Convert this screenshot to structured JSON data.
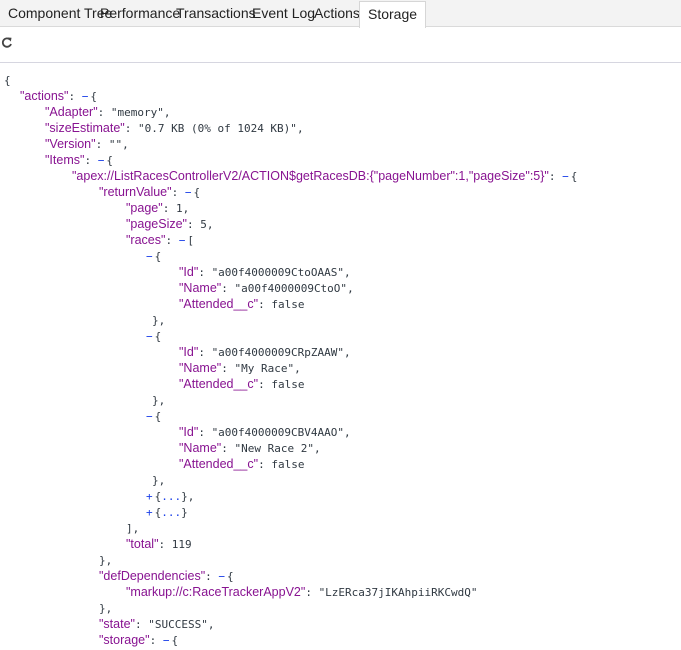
{
  "tabs": [
    {
      "label": "Component Tree",
      "active": false
    },
    {
      "label": "Performance",
      "active": false
    },
    {
      "label": "Transactions",
      "active": false
    },
    {
      "label": "Event Log",
      "active": false
    },
    {
      "label": "Actions",
      "active": false
    },
    {
      "label": "Storage",
      "active": true
    }
  ],
  "toolbar": {
    "refresh_icon": "refresh-icon"
  },
  "colors": {
    "key": "#881391",
    "value": "#303942",
    "toggle": "#1a3fe8"
  },
  "json_lines": [
    {
      "depth": 0,
      "tokens": [
        {
          "t": "punc",
          "v": "{"
        }
      ]
    },
    {
      "depth": 1,
      "tokens": [
        {
          "t": "key",
          "v": "\"actions\""
        },
        {
          "t": "punc",
          "v": ": "
        },
        {
          "t": "toggle",
          "v": "−"
        },
        {
          "t": "punc",
          "v": "{"
        }
      ]
    },
    {
      "depth": 2,
      "tokens": [
        {
          "t": "key",
          "v": "\"Adapter\""
        },
        {
          "t": "punc",
          "v": ": "
        },
        {
          "t": "str",
          "v": "\"memory\""
        },
        {
          "t": "punc",
          "v": ","
        }
      ]
    },
    {
      "depth": 2,
      "tokens": [
        {
          "t": "key",
          "v": "\"sizeEstimate\""
        },
        {
          "t": "punc",
          "v": ": "
        },
        {
          "t": "str",
          "v": "\"0.7 KB (0% of 1024 KB)\""
        },
        {
          "t": "punc",
          "v": ","
        }
      ]
    },
    {
      "depth": 2,
      "tokens": [
        {
          "t": "key",
          "v": "\"Version\""
        },
        {
          "t": "punc",
          "v": ": "
        },
        {
          "t": "str",
          "v": "\"\""
        },
        {
          "t": "punc",
          "v": ","
        }
      ]
    },
    {
      "depth": 2,
      "tokens": [
        {
          "t": "key",
          "v": "\"Items\""
        },
        {
          "t": "punc",
          "v": ": "
        },
        {
          "t": "toggle",
          "v": "−"
        },
        {
          "t": "punc",
          "v": "{"
        }
      ]
    },
    {
      "depth": 3,
      "tokens": [
        {
          "t": "key",
          "v": "\"apex://ListRacesControllerV2/ACTION$getRacesDB:{\"pageNumber\":1,\"pageSize\":5}\""
        },
        {
          "t": "punc",
          "v": ": "
        },
        {
          "t": "toggle",
          "v": "−"
        },
        {
          "t": "punc",
          "v": "{"
        }
      ]
    },
    {
      "depth": 4,
      "tokens": [
        {
          "t": "key",
          "v": "\"returnValue\""
        },
        {
          "t": "punc",
          "v": ": "
        },
        {
          "t": "toggle",
          "v": "−"
        },
        {
          "t": "punc",
          "v": "{"
        }
      ]
    },
    {
      "depth": 5,
      "tokens": [
        {
          "t": "key",
          "v": "\"page\""
        },
        {
          "t": "punc",
          "v": ": "
        },
        {
          "t": "num",
          "v": "1"
        },
        {
          "t": "punc",
          "v": ","
        }
      ]
    },
    {
      "depth": 5,
      "tokens": [
        {
          "t": "key",
          "v": "\"pageSize\""
        },
        {
          "t": "punc",
          "v": ": "
        },
        {
          "t": "num",
          "v": "5"
        },
        {
          "t": "punc",
          "v": ","
        }
      ]
    },
    {
      "depth": 5,
      "tokens": [
        {
          "t": "key",
          "v": "\"races\""
        },
        {
          "t": "punc",
          "v": ": "
        },
        {
          "t": "toggle",
          "v": "−"
        },
        {
          "t": "punc",
          "v": "["
        }
      ]
    },
    {
      "depth": 6,
      "tokens": [
        {
          "t": "toggle",
          "v": "−"
        },
        {
          "t": "punc",
          "v": "{"
        }
      ]
    },
    {
      "depth": 7,
      "tokens": [
        {
          "t": "key",
          "v": "\"Id\""
        },
        {
          "t": "punc",
          "v": ": "
        },
        {
          "t": "str",
          "v": "\"a00f4000009CtoOAAS\""
        },
        {
          "t": "punc",
          "v": ","
        }
      ]
    },
    {
      "depth": 7,
      "tokens": [
        {
          "t": "key",
          "v": "\"Name\""
        },
        {
          "t": "punc",
          "v": ": "
        },
        {
          "t": "str",
          "v": "\"a00f4000009CtoO\""
        },
        {
          "t": "punc",
          "v": ","
        }
      ]
    },
    {
      "depth": 7,
      "tokens": [
        {
          "t": "key",
          "v": "\"Attended__c\""
        },
        {
          "t": "punc",
          "v": ": "
        },
        {
          "t": "bool",
          "v": "false"
        }
      ]
    },
    {
      "depth": 6,
      "close": true,
      "tokens": [
        {
          "t": "punc",
          "v": "},"
        }
      ]
    },
    {
      "depth": 6,
      "tokens": [
        {
          "t": "toggle",
          "v": "−"
        },
        {
          "t": "punc",
          "v": "{"
        }
      ]
    },
    {
      "depth": 7,
      "tokens": [
        {
          "t": "key",
          "v": "\"Id\""
        },
        {
          "t": "punc",
          "v": ": "
        },
        {
          "t": "str",
          "v": "\"a00f4000009CRpZAAW\""
        },
        {
          "t": "punc",
          "v": ","
        }
      ]
    },
    {
      "depth": 7,
      "tokens": [
        {
          "t": "key",
          "v": "\"Name\""
        },
        {
          "t": "punc",
          "v": ": "
        },
        {
          "t": "str",
          "v": "\"My Race\""
        },
        {
          "t": "punc",
          "v": ","
        }
      ]
    },
    {
      "depth": 7,
      "tokens": [
        {
          "t": "key",
          "v": "\"Attended__c\""
        },
        {
          "t": "punc",
          "v": ": "
        },
        {
          "t": "bool",
          "v": "false"
        }
      ]
    },
    {
      "depth": 6,
      "close": true,
      "tokens": [
        {
          "t": "punc",
          "v": "},"
        }
      ]
    },
    {
      "depth": 6,
      "tokens": [
        {
          "t": "toggle",
          "v": "−"
        },
        {
          "t": "punc",
          "v": "{"
        }
      ]
    },
    {
      "depth": 7,
      "tokens": [
        {
          "t": "key",
          "v": "\"Id\""
        },
        {
          "t": "punc",
          "v": ": "
        },
        {
          "t": "str",
          "v": "\"a00f4000009CBV4AAO\""
        },
        {
          "t": "punc",
          "v": ","
        }
      ]
    },
    {
      "depth": 7,
      "tokens": [
        {
          "t": "key",
          "v": "\"Name\""
        },
        {
          "t": "punc",
          "v": ": "
        },
        {
          "t": "str",
          "v": "\"New Race 2\""
        },
        {
          "t": "punc",
          "v": ","
        }
      ]
    },
    {
      "depth": 7,
      "tokens": [
        {
          "t": "key",
          "v": "\"Attended__c\""
        },
        {
          "t": "punc",
          "v": ": "
        },
        {
          "t": "bool",
          "v": "false"
        }
      ]
    },
    {
      "depth": 6,
      "close": true,
      "tokens": [
        {
          "t": "punc",
          "v": "},"
        }
      ]
    },
    {
      "depth": 6,
      "tokens": [
        {
          "t": "toggle",
          "v": "+"
        },
        {
          "t": "punc",
          "v": "{"
        },
        {
          "t": "ell",
          "v": "..."
        },
        {
          "t": "punc",
          "v": "},"
        }
      ]
    },
    {
      "depth": 6,
      "tokens": [
        {
          "t": "toggle",
          "v": "+"
        },
        {
          "t": "punc",
          "v": "{"
        },
        {
          "t": "ell",
          "v": "..."
        },
        {
          "t": "punc",
          "v": "}"
        }
      ]
    },
    {
      "depth": 5,
      "tokens": [
        {
          "t": "punc",
          "v": "],"
        }
      ]
    },
    {
      "depth": 5,
      "tokens": [
        {
          "t": "key",
          "v": "\"total\""
        },
        {
          "t": "punc",
          "v": ": "
        },
        {
          "t": "num",
          "v": "119"
        }
      ]
    },
    {
      "depth": 4,
      "tokens": [
        {
          "t": "punc",
          "v": "},"
        }
      ]
    },
    {
      "depth": 4,
      "tokens": [
        {
          "t": "key",
          "v": "\"defDependencies\""
        },
        {
          "t": "punc",
          "v": ": "
        },
        {
          "t": "toggle",
          "v": "−"
        },
        {
          "t": "punc",
          "v": "{"
        }
      ]
    },
    {
      "depth": 5,
      "tokens": [
        {
          "t": "key",
          "v": "\"markup://c:RaceTrackerAppV2\""
        },
        {
          "t": "punc",
          "v": ": "
        },
        {
          "t": "str",
          "v": "\"LzERca37jIKAhpiiRKCwdQ\""
        }
      ]
    },
    {
      "depth": 4,
      "tokens": [
        {
          "t": "punc",
          "v": "},"
        }
      ]
    },
    {
      "depth": 4,
      "tokens": [
        {
          "t": "key",
          "v": "\"state\""
        },
        {
          "t": "punc",
          "v": ": "
        },
        {
          "t": "str",
          "v": "\"SUCCESS\""
        },
        {
          "t": "punc",
          "v": ","
        }
      ]
    },
    {
      "depth": 4,
      "tokens": [
        {
          "t": "key",
          "v": "\"storage\""
        },
        {
          "t": "punc",
          "v": ": "
        },
        {
          "t": "toggle",
          "v": "−"
        },
        {
          "t": "punc",
          "v": "{"
        }
      ]
    }
  ]
}
